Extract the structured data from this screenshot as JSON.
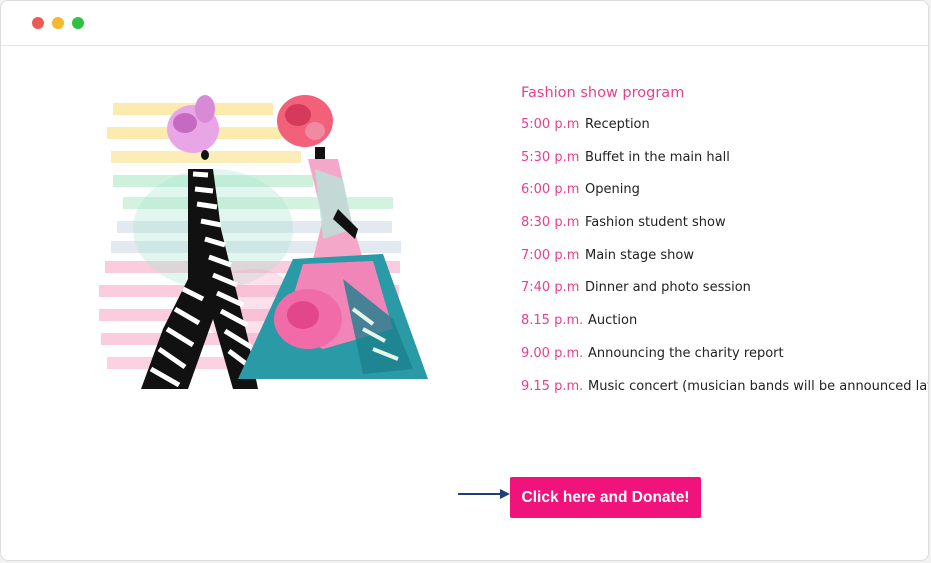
{
  "colors": {
    "accent": "#e83e8c",
    "button": "#f0137c",
    "dot_close": "#ee5a52",
    "dot_min": "#f5b82e",
    "dot_max": "#2fc142",
    "arrow": "#1f3e7a"
  },
  "program": {
    "title": "Fashion show program",
    "items": [
      {
        "time": "5:00 p.m",
        "event": "Reception"
      },
      {
        "time": "5:30 p.m",
        "event": "Buffet in the main hall"
      },
      {
        "time": "6:00 p.m",
        "event": "Opening"
      },
      {
        "time": "8:30 p.m",
        "event": "Fashion student show"
      },
      {
        "time": "7:00 p.m",
        "event": "Main stage show"
      },
      {
        "time": "7:40 p.m",
        "event": "Dinner and photo session"
      },
      {
        "time": "8.15 p.m.",
        "event": "Auction"
      },
      {
        "time": "9.00 p.m.",
        "event": "Announcing the charity report"
      },
      {
        "time": "9.15 p.m.",
        "event": "Music concert (musician bands will be announced later"
      }
    ]
  },
  "donate": {
    "label": "Click here and Donate!"
  },
  "icons": {
    "arrow": "arrow-right-icon",
    "illustration": "fashion-models-illustration"
  }
}
